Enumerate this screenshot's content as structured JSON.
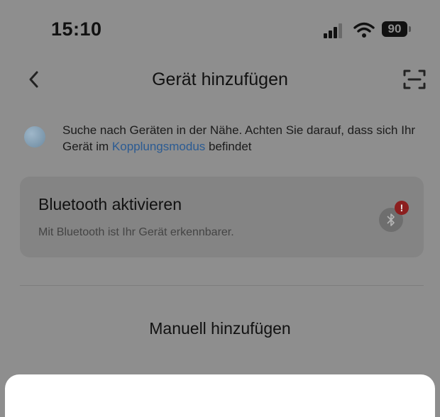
{
  "status_bar": {
    "time": "15:10",
    "battery": "90"
  },
  "nav": {
    "title": "Gerät hinzufügen",
    "back_icon": "chevron-left-icon",
    "scan_icon": "scan-icon"
  },
  "search": {
    "text_before": "Suche nach Geräten in der Nähe. Achten Sie darauf, dass sich Ihr Gerät im ",
    "link": "Kopplungsmodus",
    "text_after": " befindet"
  },
  "bluetooth_card": {
    "title": "Bluetooth aktivieren",
    "subtitle": "Mit Bluetooth ist Ihr Gerät erkennbarer.",
    "badge": "!",
    "icon": "bluetooth-icon"
  },
  "manual_add": {
    "label": "Manuell hinzufügen"
  },
  "colors": {
    "overlay_bg": "#8e8e8e",
    "link": "#2b5b93",
    "badge": "#8c1f1f",
    "sheet": "#ffffff"
  }
}
